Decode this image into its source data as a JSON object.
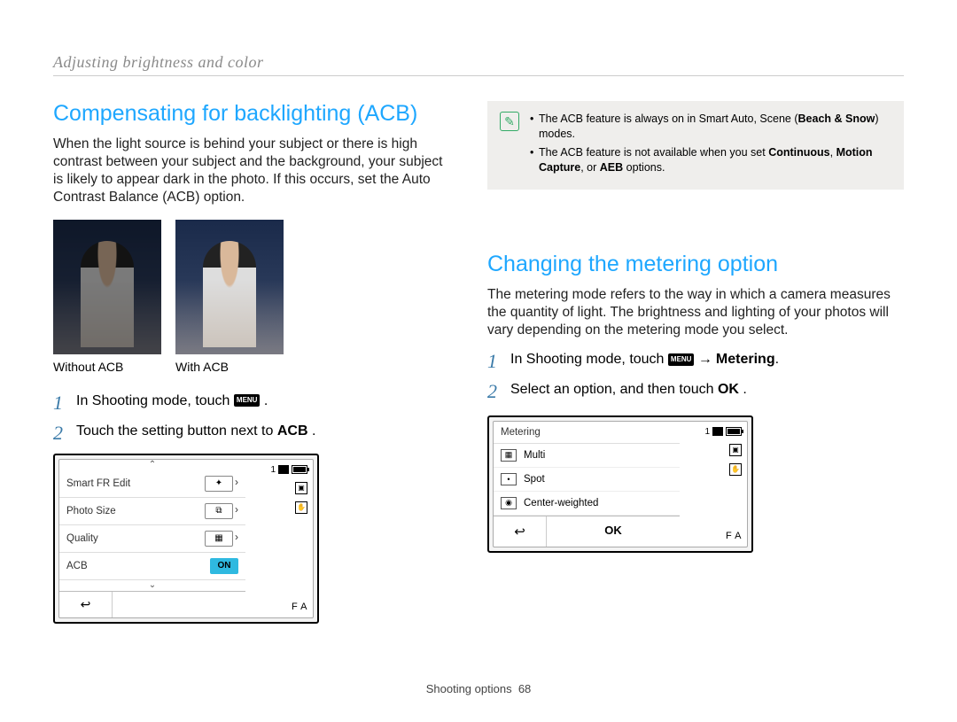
{
  "header": {
    "title": "Adjusting brightness and color"
  },
  "left": {
    "title": "Compensating for backlighting (ACB)",
    "body": "When the light source is behind your subject or there is high contrast between your subject and the background, your subject is likely to appear dark in the photo. If this occurs, set the Auto Contrast Balance (ACB) option.",
    "caption_without": "Without ACB",
    "caption_with": "With ACB",
    "steps": [
      {
        "text_a": "In Shooting mode, touch ",
        "text_b": "."
      },
      {
        "text_a": "Touch the setting button next to ",
        "bold": "ACB",
        "text_b": "."
      }
    ],
    "screen": {
      "status_count": "1",
      "rows": [
        {
          "label": "Smart FR Edit",
          "type": "toggle"
        },
        {
          "label": "Photo Size",
          "type": "toggle"
        },
        {
          "label": "Quality",
          "type": "toggle"
        },
        {
          "label": "ACB",
          "type": "on",
          "value": "ON"
        }
      ],
      "flash": "F A"
    }
  },
  "right": {
    "note": {
      "line1_a": "The ACB feature is always on in Smart Auto, Scene (",
      "line1_bold": "Beach & Snow",
      "line1_b": ") modes.",
      "line2_a": "The ACB feature is not available when you set ",
      "line2_b1": "Continuous",
      "line2_m": ", ",
      "line2_b2": "Motion Capture",
      "line2_m2": ", or ",
      "line2_b3": "AEB",
      "line2_end": " options."
    },
    "title": "Changing the metering option",
    "body": "The metering mode refers to the way in which a camera measures the quantity of light. The brightness and lighting of your photos will vary depending on the metering mode you select.",
    "steps": [
      {
        "text_a": "In Shooting mode, touch ",
        "text_b": " → ",
        "bold": "Metering",
        "text_c": "."
      },
      {
        "text_a": "Select an option, and then touch ",
        "ok": "OK",
        "text_b": "."
      }
    ],
    "screen": {
      "title": "Metering",
      "options": [
        "Multi",
        "Spot",
        "Center-weighted"
      ],
      "ok": "OK",
      "status_count": "1",
      "flash": "F A"
    }
  },
  "footer": {
    "section": "Shooting options",
    "page": "68"
  }
}
